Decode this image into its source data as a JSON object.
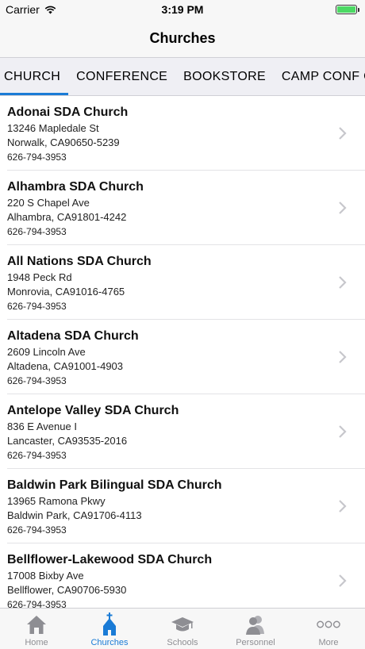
{
  "status": {
    "carrier": "Carrier",
    "time": "3:19 PM"
  },
  "nav": {
    "title": "Churches"
  },
  "tabs": [
    {
      "label": "CHURCH",
      "active": true
    },
    {
      "label": "CONFERENCE",
      "active": false
    },
    {
      "label": "BOOKSTORE",
      "active": false
    },
    {
      "label": "CAMP CONF CENTE",
      "active": false
    }
  ],
  "churches": [
    {
      "name": "Adonai SDA Church",
      "street": "13246 Mapledale St",
      "city": "Norwalk, CA90650-5239",
      "phone": "626-794-3953"
    },
    {
      "name": "Alhambra SDA Church",
      "street": "220 S Chapel Ave",
      "city": "Alhambra, CA91801-4242",
      "phone": "626-794-3953"
    },
    {
      "name": "All Nations SDA Church",
      "street": "1948 Peck Rd",
      "city": "Monrovia, CA91016-4765",
      "phone": "626-794-3953"
    },
    {
      "name": "Altadena SDA Church",
      "street": "2609 Lincoln Ave",
      "city": "Altadena, CA91001-4903",
      "phone": "626-794-3953"
    },
    {
      "name": "Antelope Valley SDA Church",
      "street": "836 E Avenue I",
      "city": "Lancaster, CA93535-2016",
      "phone": "626-794-3953"
    },
    {
      "name": "Baldwin Park Bilingual SDA Church",
      "street": "13965 Ramona Pkwy",
      "city": "Baldwin Park, CA91706-4113",
      "phone": "626-794-3953"
    },
    {
      "name": "Bellflower-Lakewood SDA Church",
      "street": "17008 Bixby Ave",
      "city": "Bellflower, CA90706-5930",
      "phone": "626-794-3953"
    }
  ],
  "tabbar": {
    "home": "Home",
    "churches": "Churches",
    "schools": "Schools",
    "personnel": "Personnel",
    "more": "More"
  },
  "colors": {
    "accent": "#1a7bd6",
    "inactive": "#8e8e93",
    "battery": "#4cd964"
  }
}
